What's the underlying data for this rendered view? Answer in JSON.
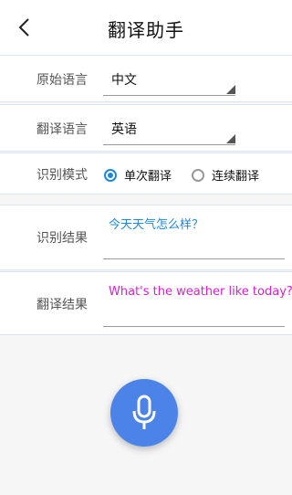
{
  "header": {
    "title": "翻译助手"
  },
  "source_language": {
    "label": "原始语言",
    "value": "中文"
  },
  "target_language": {
    "label": "翻译语言",
    "value": "英语"
  },
  "recognition_mode": {
    "label": "识别模式",
    "options": [
      {
        "label": "单次翻译",
        "checked": true
      },
      {
        "label": "连续翻译",
        "checked": false
      }
    ]
  },
  "recognition_result": {
    "label": "识别结果",
    "text": "今天天气怎么样？",
    "color": "#1e88d8"
  },
  "translation_result": {
    "label": "翻译结果",
    "text": "What's the weather like today?",
    "color": "#d61fd0"
  },
  "colors": {
    "accent": "#1e88d8",
    "mic_button": "#4b83e8"
  },
  "icons": {
    "back": "chevron-left-icon",
    "mic": "microphone-icon"
  }
}
